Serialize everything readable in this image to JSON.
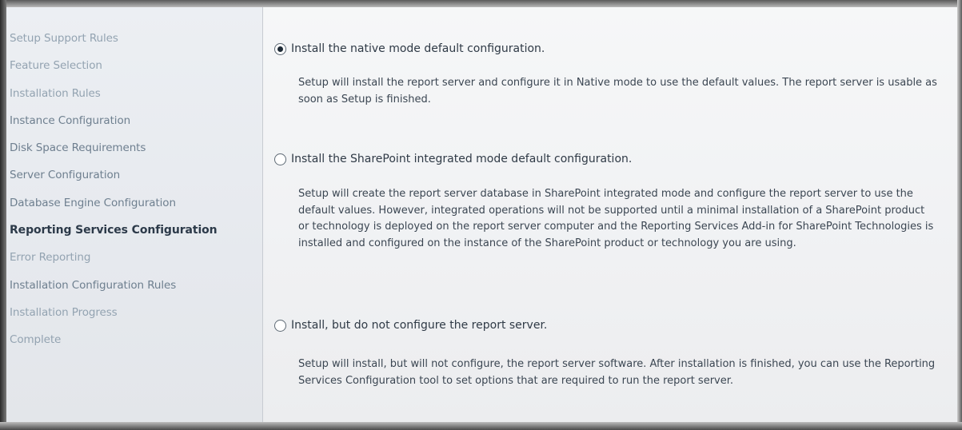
{
  "sidebar": {
    "items": [
      {
        "label": "Setup Support Rules",
        "state": "dim"
      },
      {
        "label": "Feature Selection",
        "state": "dim"
      },
      {
        "label": "Installation Rules",
        "state": "dim"
      },
      {
        "label": "Instance Configuration",
        "state": "normal"
      },
      {
        "label": "Disk Space Requirements",
        "state": "normal"
      },
      {
        "label": "Server Configuration",
        "state": "normal"
      },
      {
        "label": "Database Engine Configuration",
        "state": "normal"
      },
      {
        "label": "Reporting Services Configuration",
        "state": "active"
      },
      {
        "label": "Error Reporting",
        "state": "dim"
      },
      {
        "label": "Installation Configuration Rules",
        "state": "normal"
      },
      {
        "label": "Installation Progress",
        "state": "dim"
      },
      {
        "label": "Complete",
        "state": "dim"
      }
    ]
  },
  "options": [
    {
      "label": "Install the native mode default configuration.",
      "selected": true,
      "description": "Setup will install the report server and configure it in Native mode to use the default values. The report server is usable as soon as Setup is finished."
    },
    {
      "label": "Install the SharePoint integrated mode default configuration.",
      "selected": false,
      "description": "Setup will create the report server database in SharePoint integrated mode and configure the report server to use the default values. However, integrated operations will not be supported until a minimal installation of a SharePoint product or technology is deployed on the report server computer and the Reporting Services Add-in for SharePoint Technologies is installed and configured on the instance of the SharePoint product or technology you are using."
    },
    {
      "label": "Install, but do not configure the report server.",
      "selected": false,
      "description": "Setup will install, but will not configure, the report server software. After installation is finished, you can use the Reporting Services Configuration tool to set options that are required to run the report server."
    }
  ]
}
